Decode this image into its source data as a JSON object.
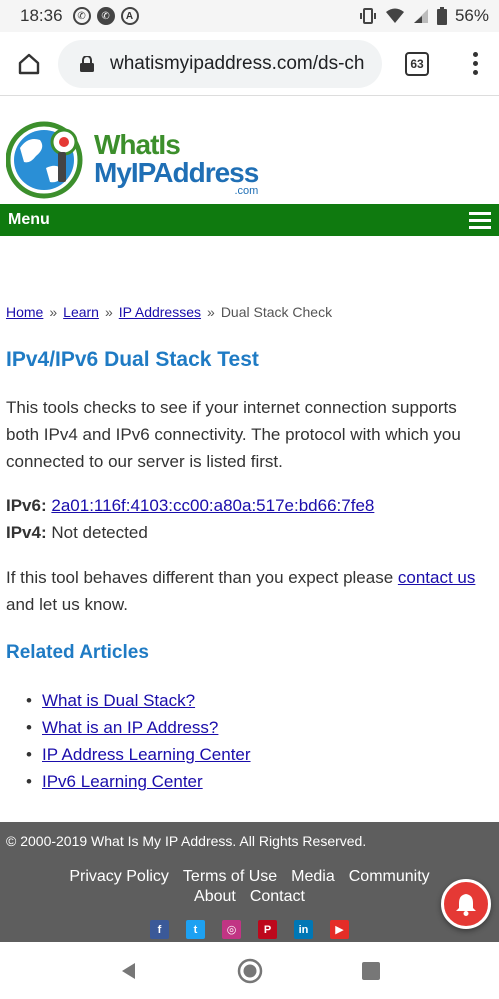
{
  "status_bar": {
    "time": "18:36",
    "battery": "56%",
    "icons": [
      "chat-bubble-icon",
      "phone-icon",
      "a-icon",
      "vibrate-icon",
      "wifi-icon",
      "signal-icon",
      "battery-icon"
    ]
  },
  "browser": {
    "url": "whatismyipaddress.com/ds-ch",
    "tab_count": "63"
  },
  "logo": {
    "line1": "WhatIs",
    "line2": "MyIPAddress",
    "suffix": ".com"
  },
  "nav": {
    "menu_label": "Menu"
  },
  "breadcrumb": {
    "items": [
      "Home",
      "Learn",
      "IP Addresses"
    ],
    "separator": "»",
    "current": "Dual Stack Check"
  },
  "page": {
    "title": "IPv4/IPv6 Dual Stack Test",
    "intro": "This tools checks to see if your internet connection supports both IPv4 and IPv6 connectivity. The protocol with which you connected to our server is listed first.",
    "ipv6_label": "IPv6:",
    "ipv6_value": "2a01:116f:4103:cc00:a80a:517e:bd66:7fe8",
    "ipv4_label": "IPv4:",
    "ipv4_value": "Not detected",
    "note_before": "If this tool behaves different than you expect please ",
    "note_link": "contact us",
    "note_after": " and let us know.",
    "related_title": "Related Articles",
    "related": [
      "What is Dual Stack?",
      "What is an IP Address?",
      "IP Address Learning Center",
      "IPv6 Learning Center"
    ]
  },
  "footer": {
    "copyright": "© 2000-2019 What Is My IP Address. All Rights Reserved.",
    "links": [
      "Privacy Policy",
      "Terms of Use",
      "Media",
      "Community",
      "About",
      "Contact"
    ],
    "social": [
      {
        "name": "facebook",
        "glyph": "f",
        "color": "#3b5998"
      },
      {
        "name": "twitter",
        "glyph": "t",
        "color": "#1da1f2"
      },
      {
        "name": "instagram",
        "glyph": "◎",
        "color": "#c13584"
      },
      {
        "name": "pinterest",
        "glyph": "P",
        "color": "#bd081c"
      },
      {
        "name": "linkedin",
        "glyph": "in",
        "color": "#0077b5"
      },
      {
        "name": "youtube",
        "glyph": "▶",
        "color": "#e52d27"
      }
    ]
  },
  "colors": {
    "nav_green": "#0f7a0f",
    "heading_blue": "#1f7bc4",
    "link_blue": "#1a0dab",
    "footer_gray": "#5e5e5e"
  }
}
